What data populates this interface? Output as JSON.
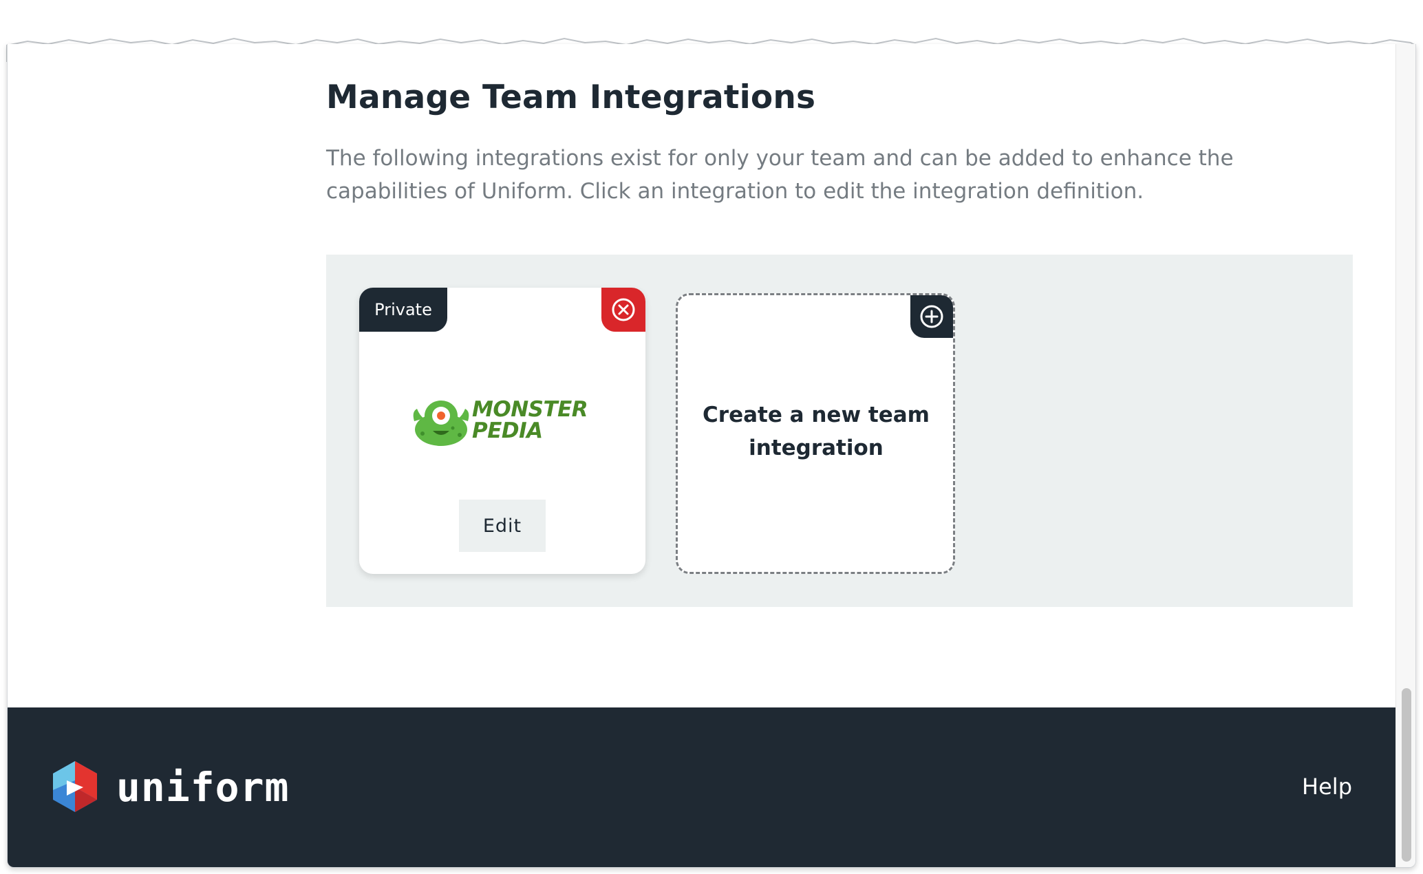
{
  "header": {
    "title": "Manage Team Integrations",
    "description": "The following integrations exist for only your team and can be added to enhance the capabilities of Uniform. Click an integration to edit the integration definition."
  },
  "integrations": [
    {
      "badge": "Private",
      "logo_line1": "MONSTER",
      "logo_line2": "PEDIA",
      "edit_label": "Edit",
      "remove_icon": "close-circle-icon",
      "logo_icon": "monster-icon"
    }
  ],
  "create_card": {
    "label": "Create a new team integration",
    "icon": "plus-circle-icon"
  },
  "footer": {
    "brand": "uniform",
    "help_label": "Help"
  },
  "colors": {
    "dark": "#1e2933",
    "danger": "#d9262a",
    "panel": "#ecf0f0",
    "logo_green": "#4a8a27",
    "brand_red": "#e3342f",
    "brand_blue": "#3b86d6",
    "brand_cyan": "#6cc5e8"
  }
}
